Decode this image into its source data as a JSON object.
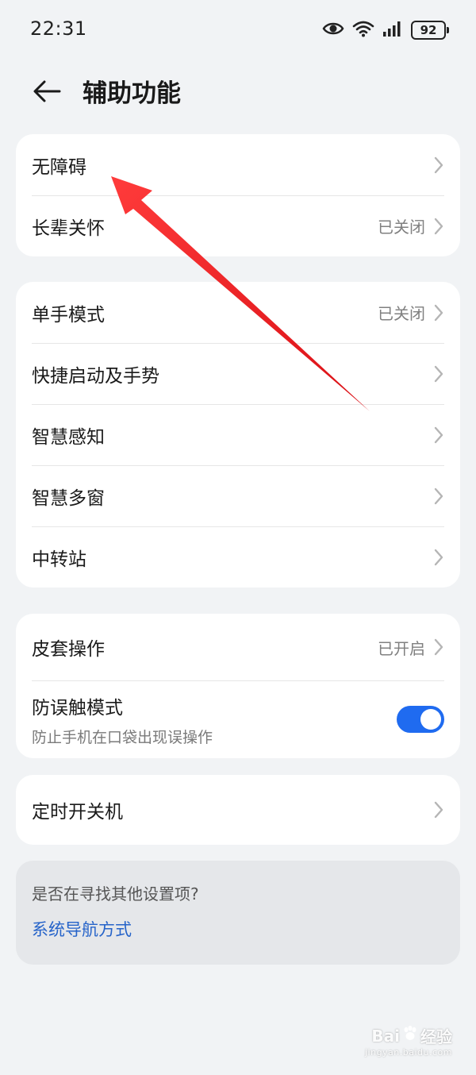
{
  "status": {
    "time": "22:31",
    "icons": [
      "eye-icon",
      "wifi-icon",
      "signal-icon"
    ],
    "battery": "92"
  },
  "header": {
    "title": "辅助功能"
  },
  "sections": {
    "group1": [
      {
        "label": "无障碍",
        "value": ""
      },
      {
        "label": "长辈关怀",
        "value": "已关闭"
      }
    ],
    "group2": [
      {
        "label": "单手模式",
        "value": "已关闭"
      },
      {
        "label": "快捷启动及手势",
        "value": ""
      },
      {
        "label": "智慧感知",
        "value": ""
      },
      {
        "label": "智慧多窗",
        "value": ""
      },
      {
        "label": "中转站",
        "value": ""
      }
    ],
    "group3": {
      "cover": {
        "label": "皮套操作",
        "value": "已开启"
      },
      "mistouch": {
        "label": "防误触模式",
        "sub": "防止手机在口袋出现误操作",
        "enabled": true
      }
    },
    "group4": [
      {
        "label": "定时开关机",
        "value": ""
      }
    ]
  },
  "suggestion": {
    "question": "是否在寻找其他设置项?",
    "link": "系统导航方式"
  },
  "annotation": {
    "color": "#e8141a"
  },
  "watermark": {
    "brand": "Bai",
    "brand_suffix": "经验",
    "url": "jingyan.baidu.com"
  },
  "colors": {
    "accent": "#1f6bf0",
    "link": "#2563c9",
    "background": "#f1f3f5"
  }
}
